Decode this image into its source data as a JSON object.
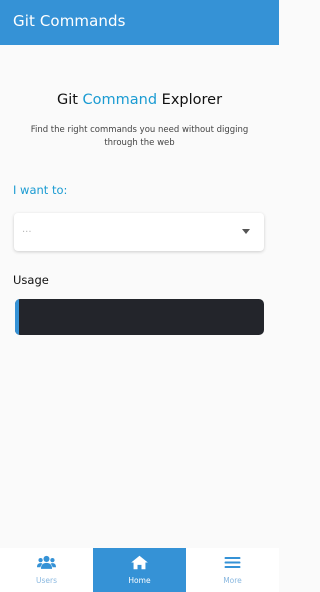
{
  "app_bar": {
    "title": "Git Commands"
  },
  "hero": {
    "title_part1": "Git ",
    "title_accent": "Command",
    "title_part2": " Explorer",
    "subtitle": "Find the right commands you need without digging through the web"
  },
  "form": {
    "want_label": "I want to:",
    "select_value": "...",
    "usage_label": "Usage",
    "usage_code": ""
  },
  "bottom_nav": {
    "items": [
      {
        "label": "Users",
        "icon": "users-icon",
        "active": false
      },
      {
        "label": "Home",
        "icon": "home-icon",
        "active": true
      },
      {
        "label": "More",
        "icon": "menu-icon",
        "active": false
      }
    ]
  },
  "colors": {
    "primary": "#3592d6",
    "accent_text": "#1a9bd2",
    "usage_bg": "#23252b"
  }
}
